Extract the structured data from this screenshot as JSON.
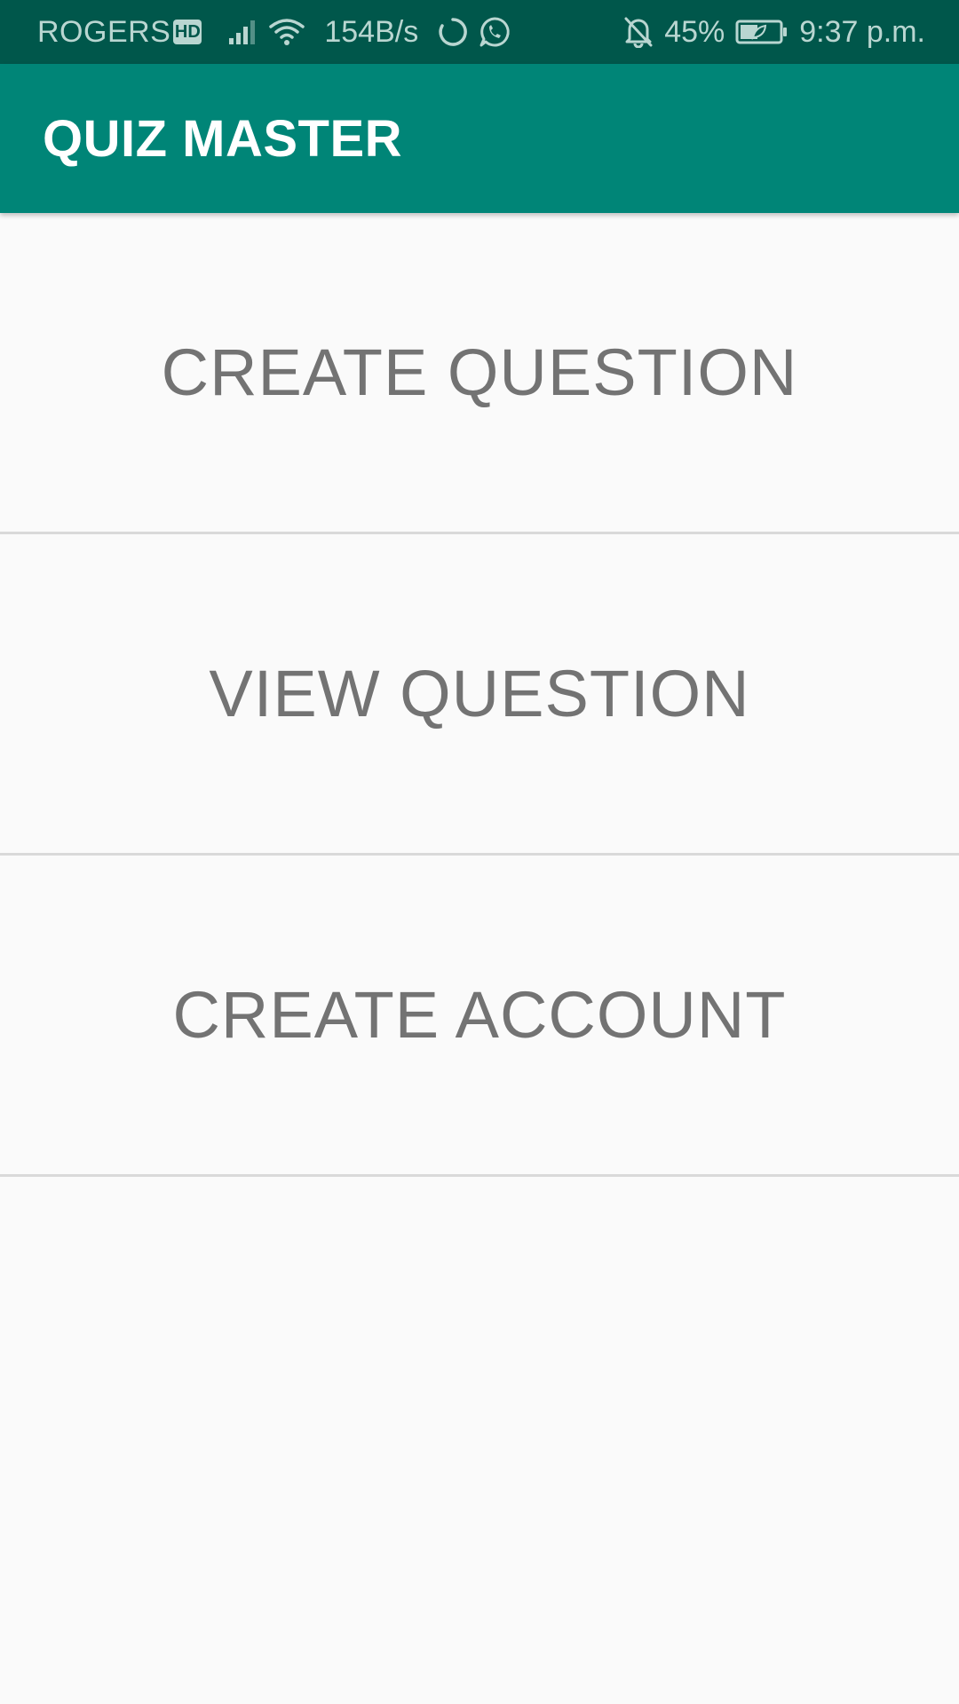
{
  "status_bar": {
    "carrier": "ROGERS",
    "hd_badge": "HD",
    "network_speed": "154B/s",
    "battery_percent": "45%",
    "battery_level": 0.45,
    "time": "9:37 p.m.",
    "icons": [
      "signal-icon",
      "wifi-icon",
      "sync-icon",
      "whatsapp-icon",
      "notifications-off-icon",
      "battery-saver-icon"
    ]
  },
  "app_bar": {
    "title": "QUIZ MASTER"
  },
  "menu": {
    "items": [
      {
        "label": "CREATE QUESTION"
      },
      {
        "label": "VIEW QUESTION"
      },
      {
        "label": "CREATE ACCOUNT"
      }
    ]
  },
  "colors": {
    "status_bar": "#00574b",
    "app_bar": "#008577",
    "background": "#fafafa",
    "menu_text": "#737373",
    "divider": "#d9d9d9"
  }
}
